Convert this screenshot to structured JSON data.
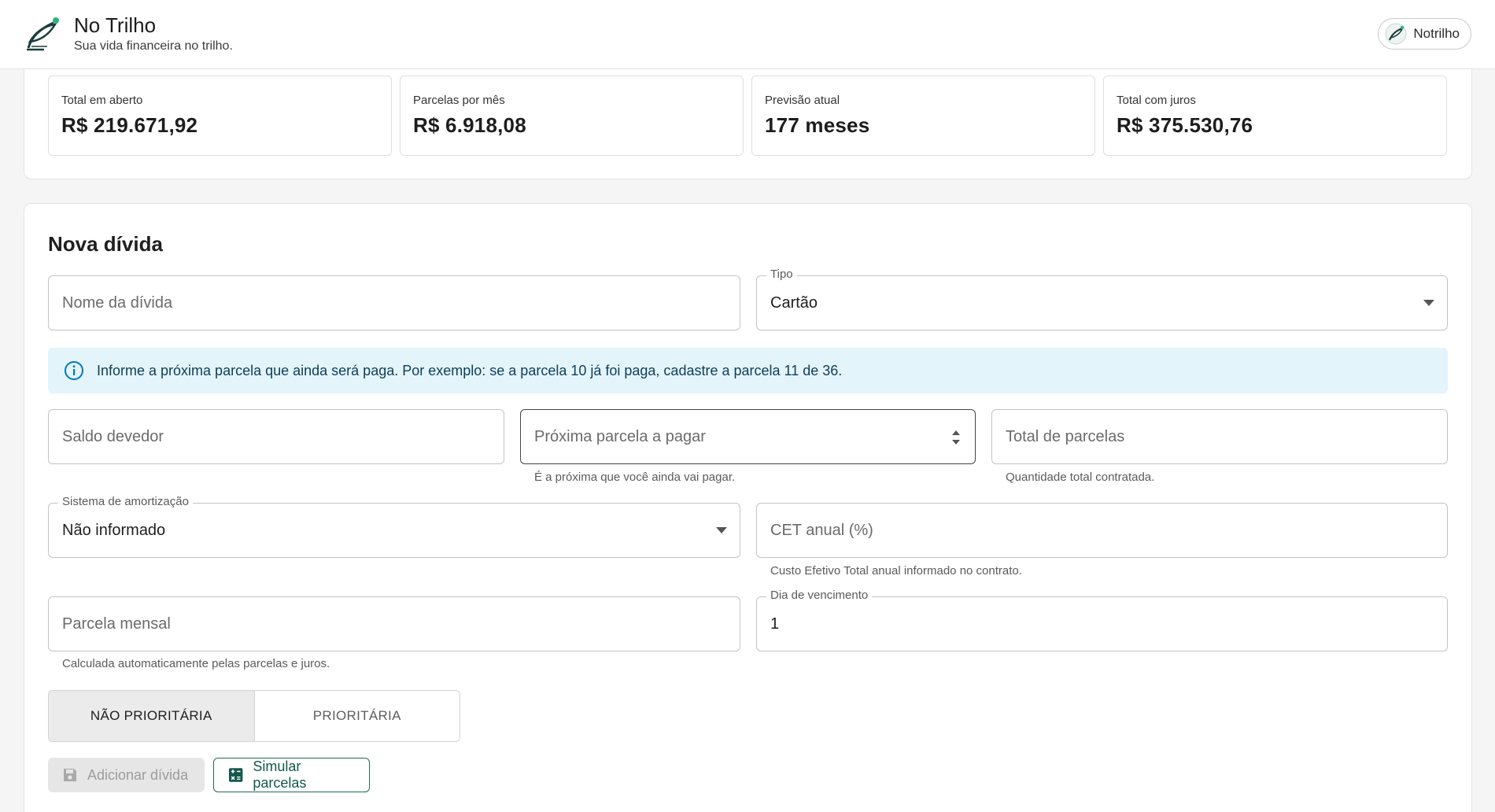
{
  "header": {
    "title": "No Trilho",
    "subtitle": "Sua vida financeira no trilho.",
    "user_label": "Notrilho"
  },
  "summary": {
    "cards": [
      {
        "label": "Total em aberto",
        "value": "R$ 219.671,92"
      },
      {
        "label": "Parcelas por mês",
        "value": "R$ 6.918,08"
      },
      {
        "label": "Previsão atual",
        "value": "177 meses"
      },
      {
        "label": "Total com juros",
        "value": "R$ 375.530,76"
      }
    ]
  },
  "form": {
    "title": "Nova dívida",
    "nome": {
      "placeholder": "Nome da dívida"
    },
    "tipo": {
      "label": "Tipo",
      "value": "Cartão"
    },
    "info": "Informe a próxima parcela que ainda será paga. Por exemplo: se a parcela 10 já foi paga, cadastre a parcela 11 de 36.",
    "saldo": {
      "placeholder": "Saldo devedor"
    },
    "proxima": {
      "placeholder": "Próxima parcela a pagar",
      "helper": "É a próxima que você ainda vai pagar."
    },
    "total_parcelas": {
      "placeholder": "Total de parcelas",
      "helper": "Quantidade total contratada."
    },
    "amortizacao": {
      "label": "Sistema de amortização",
      "value": "Não informado"
    },
    "cet": {
      "placeholder": "CET anual (%)",
      "helper": "Custo Efetivo Total anual informado no contrato."
    },
    "parcela_mensal": {
      "placeholder": "Parcela mensal",
      "helper": "Calculada automaticamente pelas parcelas e juros."
    },
    "vencimento": {
      "label": "Dia de vencimento",
      "value": "1"
    },
    "priority": {
      "non_priority": "NÃO PRIORITÁRIA",
      "priority": "PRIORITÁRIA"
    },
    "actions": {
      "add": "Adicionar dívida",
      "simulate": "Simular parcelas"
    }
  },
  "colors": {
    "accent": "#14584a",
    "info_bg": "#e3f4fb",
    "info_icon": "#0277bd"
  }
}
